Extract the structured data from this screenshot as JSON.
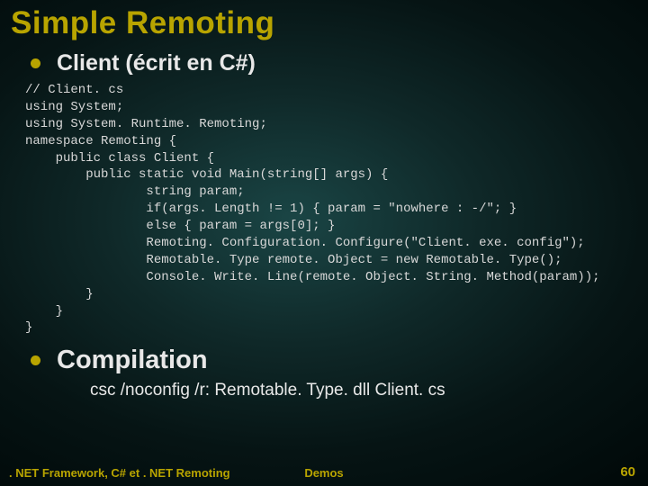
{
  "title": "Simple Remoting",
  "bullet1": "Client (écrit en C#)",
  "code": "// Client. cs\nusing System;\nusing System. Runtime. Remoting;\nnamespace Remoting {\n    public class Client {\n        public static void Main(string[] args) {\n                string param;\n                if(args. Length != 1) { param = \"nowhere : -/\"; }\n                else { param = args[0]; }\n                Remoting. Configuration. Configure(\"Client. exe. config\");\n                Remotable. Type remote. Object = new Remotable. Type();\n                Console. Write. Line(remote. Object. String. Method(param));\n        }\n    }\n}",
  "bullet2": "Compilation",
  "subline": "csc /noconfig /r: Remotable. Type. dll Client. cs",
  "footer": {
    "left": ". NET Framework, C# et . NET Remoting",
    "center": "Demos",
    "right": "60"
  }
}
